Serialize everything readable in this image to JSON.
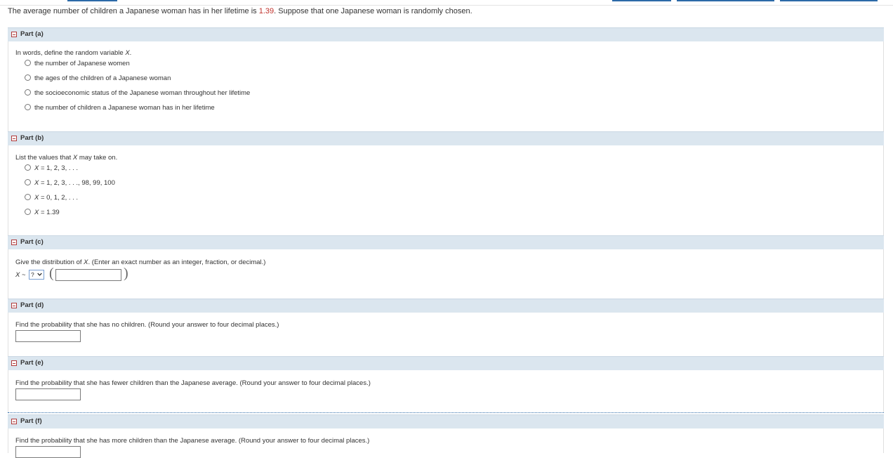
{
  "intro": {
    "before": "The average number of children a Japanese woman has in her lifetime is ",
    "value": "1.39",
    "after": ". Suppose that one Japanese woman is randomly chosen."
  },
  "part_a": {
    "title": "Part (a)",
    "prompt": {
      "before": "In words, define the random variable ",
      "var": "X",
      "after": "."
    },
    "options": [
      "the number of Japanese women",
      "the ages of the children of a Japanese woman",
      "the socioeconomic status of the Japanese woman throughout her lifetime",
      "the number of children a Japanese woman has in her lifetime"
    ]
  },
  "part_b": {
    "title": "Part (b)",
    "prompt": {
      "before": "List the values that ",
      "var": "X",
      "after": " may take on."
    },
    "var": "X",
    "options": [
      " = 1, 2, 3, . . .",
      " = 1, 2, 3, . . ., 98, 99, 100",
      " = 0, 1, 2, . . .",
      " = 1.39"
    ]
  },
  "part_c": {
    "title": "Part (c)",
    "prompt": {
      "before": "Give the distribution of ",
      "var": "X",
      "after": ". (Enter an exact number as an integer, fraction, or decimal.)"
    },
    "lhs_var": "X",
    "tilde": " ~",
    "select_value": "?",
    "open_paren": "(",
    "close_paren": ")"
  },
  "part_d": {
    "title": "Part (d)",
    "prompt": "Find the probability that she has no children. (Round your answer to four decimal places.)"
  },
  "part_e": {
    "title": "Part (e)",
    "prompt": "Find the probability that she has fewer children than the Japanese average. (Round your answer to four decimal places.)"
  },
  "part_f": {
    "title": "Part (f)",
    "prompt": "Find the probability that she has more children than the Japanese average. (Round your answer to four decimal places.)"
  },
  "colors": {
    "accent": "#2c6aa8",
    "highlight": "#c0302a",
    "header_bg": "#dbe6ef"
  }
}
